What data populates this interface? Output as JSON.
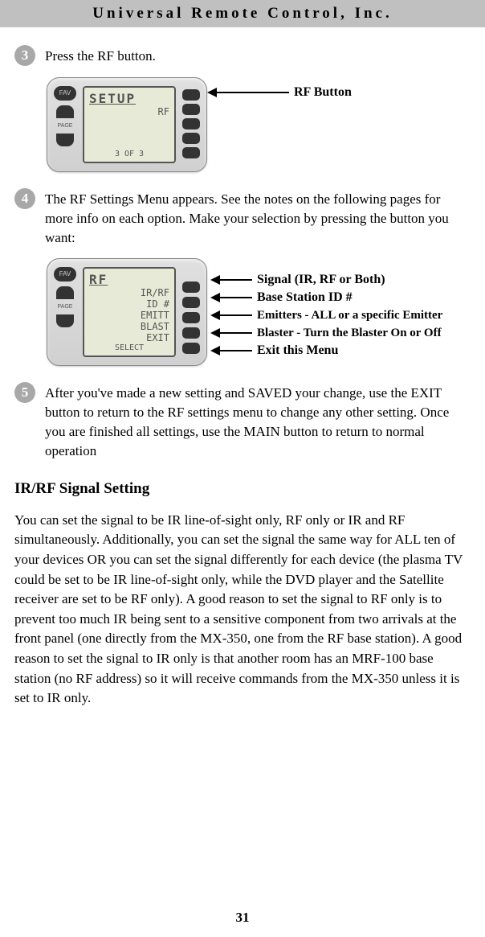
{
  "header": {
    "title": "Universal Remote Control, Inc."
  },
  "steps": [
    {
      "num": "3",
      "text": "Press the RF button."
    },
    {
      "num": "4",
      "text": "The RF Settings Menu appears. See the notes on the following pages for more info on each option. Make your selection by pressing the button you want:"
    },
    {
      "num": "5",
      "text": "After you've made a new setting and SAVED your change, use the EXIT button to return to the RF settings menu to change any other setting. Once you are finished all settings, use the MAIN button to return to normal operation"
    }
  ],
  "fig1": {
    "lcd_title": "SETUP",
    "lcd_line": "RF",
    "lcd_footer": "3 OF 3",
    "callout": "RF Button"
  },
  "fig2": {
    "lcd_title": "RF",
    "lines": [
      "IR/RF",
      "ID #",
      "EMITT",
      "BLAST",
      "EXIT"
    ],
    "lcd_footer": "SELECT",
    "callouts": [
      "Signal (IR, RF or Both)",
      "Base Station ID #",
      "Emitters - ALL or a specific Emitter",
      "Blaster - Turn the Blaster On or Off",
      "Exit this Menu"
    ]
  },
  "section": {
    "title": "IR/RF Signal Setting"
  },
  "paragraph": "You can set the signal to be IR line-of-sight only, RF only or IR and RF simultaneously. Additionally, you can set the signal the same way for ALL ten of your devices OR you can set the signal differently for each device (the plasma TV could be set to be IR line-of-sight only, while the DVD player and the Satellite receiver are set to be RF only). A good reason to set the signal to RF only is to prevent too much IR being sent to a sensitive component from two arrivals at the front panel (one directly from the MX-350, one from the RF base station). A good reason to set the signal to IR only is that another room has an MRF-100 base station (no RF address) so it will receive commands from the MX-350 unless it is set to IR only.",
  "page_number": "31",
  "left_buttons": {
    "fav": "FAV",
    "page": "PAGE"
  }
}
